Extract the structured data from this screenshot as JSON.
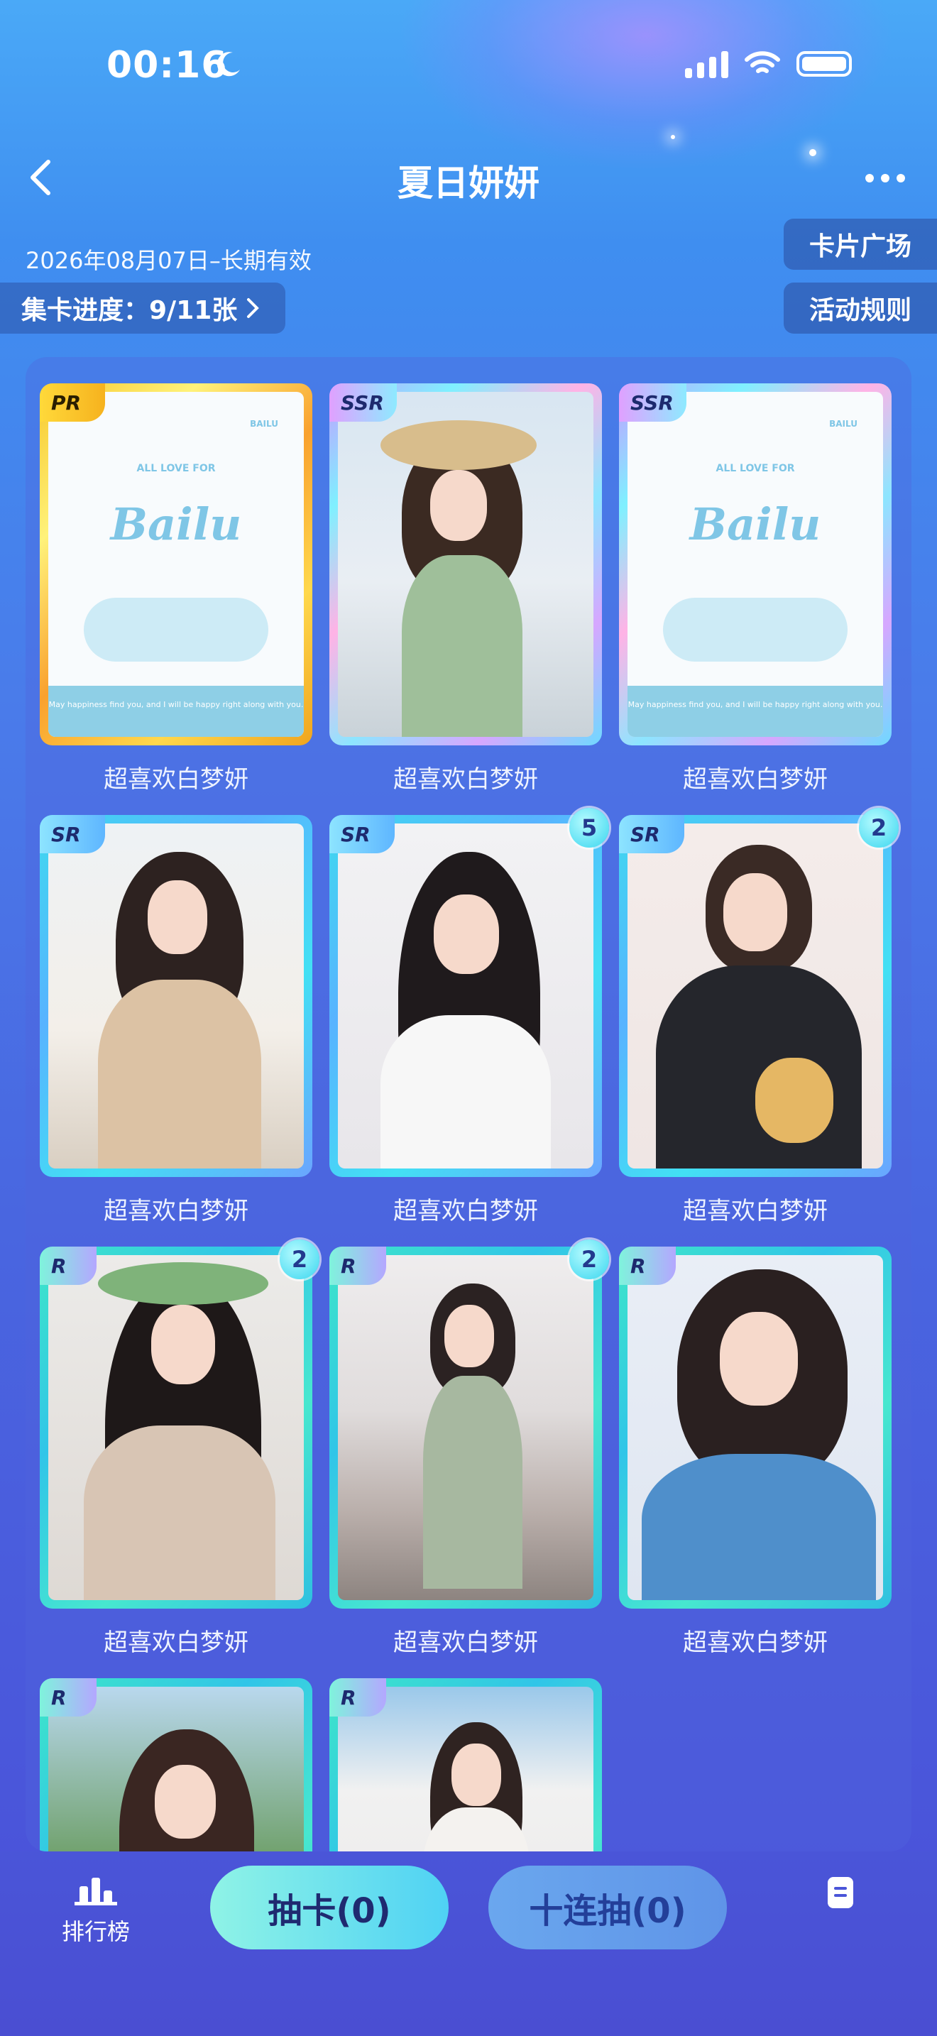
{
  "status_bar": {
    "time": "00:16"
  },
  "nav": {
    "title": "夏日妍妍"
  },
  "header": {
    "date_text": "2026年08月07日–长期有效",
    "progress_text": "集卡进度：9/11张",
    "card_square_label": "卡片广场",
    "event_rules_label": "活动规则"
  },
  "cards": [
    {
      "rarity": "PR",
      "name": "超喜欢白梦妍",
      "count": "",
      "type": "bailu"
    },
    {
      "rarity": "SSR",
      "name": "超喜欢白梦妍",
      "count": ""
    },
    {
      "rarity": "SSR",
      "name": "超喜欢白梦妍",
      "count": "",
      "type": "bailu"
    },
    {
      "rarity": "SR",
      "name": "超喜欢白梦妍",
      "count": ""
    },
    {
      "rarity": "SR",
      "name": "超喜欢白梦妍",
      "count": "5"
    },
    {
      "rarity": "SR",
      "name": "超喜欢白梦妍",
      "count": "2"
    },
    {
      "rarity": "R",
      "name": "超喜欢白梦妍",
      "count": "2"
    },
    {
      "rarity": "R",
      "name": "超喜欢白梦妍",
      "count": "2"
    },
    {
      "rarity": "R",
      "name": "超喜欢白梦妍",
      "count": ""
    },
    {
      "rarity": "R",
      "name": "",
      "count": ""
    },
    {
      "rarity": "R",
      "name": "",
      "count": ""
    }
  ],
  "bailu_art": {
    "top_text": "ALL LOVE FOR",
    "word": "Bailu",
    "brand": "BAILU",
    "strip_text": "May happiness find you, and I will be happy right along with you."
  },
  "bottom_bar": {
    "ranking_label": "排行榜",
    "draw_label": "抽卡(0)",
    "draw10_label": "十连抽(0)"
  }
}
